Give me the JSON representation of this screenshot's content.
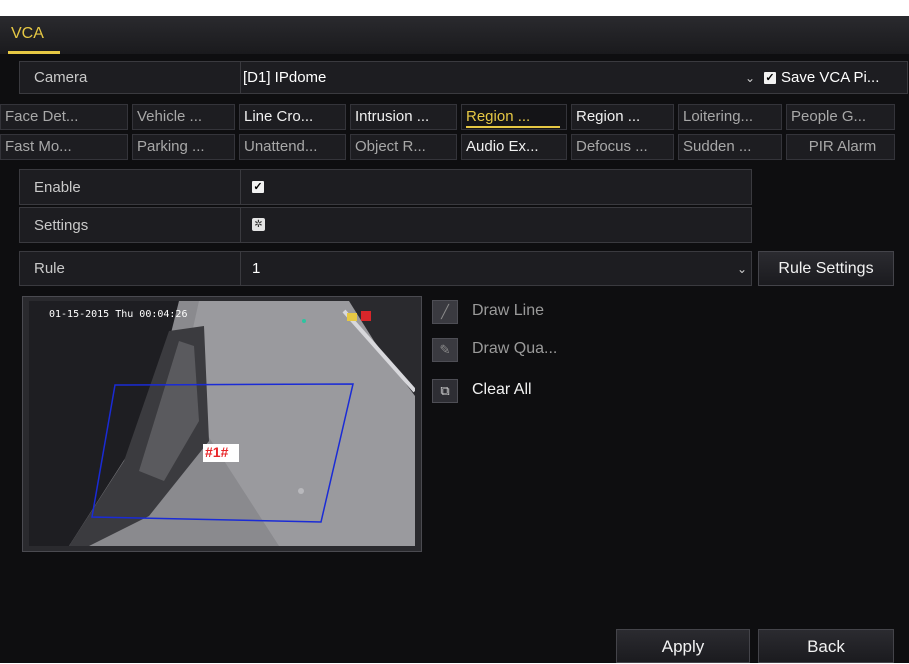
{
  "window": {
    "title": "VCA"
  },
  "camera": {
    "label": "Camera",
    "value": "[D1] IPdome",
    "save_label": "Save VCA Pi...",
    "save_checked": true
  },
  "tabs_row1": [
    "Face Det...",
    "Vehicle ...",
    "Line Cro...",
    "Intrusion ...",
    "Region ...",
    "Region ...",
    "Loitering...",
    "People G..."
  ],
  "tabs_row2": [
    "Fast Mo...",
    "Parking ...",
    "Unattend...",
    "Object R...",
    "Audio Ex...",
    "Defocus ...",
    "Sudden ...",
    "PIR Alarm"
  ],
  "active_tab": "Region ...",
  "enable": {
    "label": "Enable",
    "checked": true
  },
  "settings": {
    "label": "Settings"
  },
  "rule": {
    "label": "Rule",
    "value": "1",
    "settings_button": "Rule Settings"
  },
  "preview": {
    "timestamp": "01-15-2015 Thu 00:04:26",
    "region_label": "#1#"
  },
  "tools": {
    "draw_line": "Draw Line",
    "draw_quad": "Draw Qua...",
    "clear_all": "Clear All"
  },
  "footer": {
    "apply": "Apply",
    "back": "Back"
  },
  "colors": {
    "accent": "#e6c844",
    "region_outline": "#1a2bd6",
    "region_label": "#e8262a"
  }
}
